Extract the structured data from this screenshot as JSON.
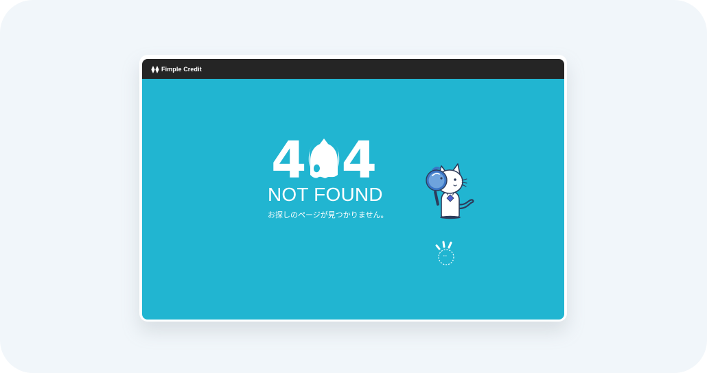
{
  "brand": {
    "name": "Fimple Credit",
    "logo_icon": "diamond-pair-logo"
  },
  "error": {
    "code": "404",
    "title": "NOT FOUND",
    "message": "お探しのページが見つかりません。"
  },
  "illustration": {
    "character": "cat-with-magnifying-glass-icon",
    "indicator": "dashed-circle-loader-icon"
  },
  "colors": {
    "page_background": "#f1f6fa",
    "topbar": "#252525",
    "content_background": "#21b5d1",
    "text": "#ffffff",
    "magnifier_accent": "#3b74c4"
  }
}
